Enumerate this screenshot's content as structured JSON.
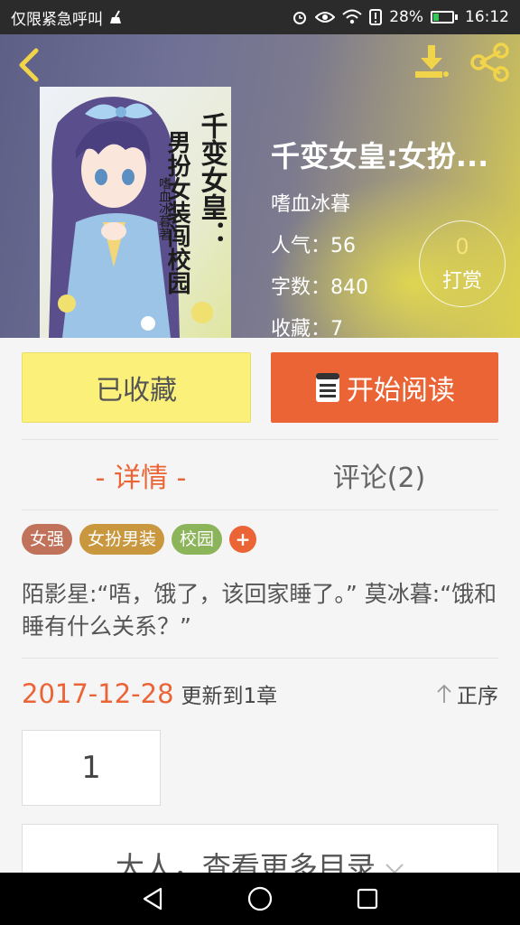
{
  "status_bar": {
    "carrier": "仅限紧急呼叫",
    "battery_pct": "28%",
    "battery_level": 0.28,
    "time": "16:12",
    "icons": [
      "broom-icon",
      "alarm-icon",
      "eye-icon",
      "wifi-icon",
      "sim-alert-icon",
      "battery-icon"
    ]
  },
  "book": {
    "title": "千变女皇:女扮...",
    "author": "嗜血冰暮",
    "popularity": "人气：56",
    "word_count": "字数：840",
    "favorites": "收藏：7",
    "cover_text": {
      "title_col1": "千变女皇：",
      "title_col2": "男扮女装闯校园",
      "author_col": "嗜血冰暮著"
    }
  },
  "tip": {
    "count": "0",
    "label": "打赏"
  },
  "actions": {
    "collected_label": "已收藏",
    "read_label": "开始阅读"
  },
  "tabs": [
    {
      "label": "- 详情 -",
      "active": true
    },
    {
      "label": "评论(2)",
      "active": false
    }
  ],
  "tags": [
    {
      "label": "女强",
      "color": "#c0725a"
    },
    {
      "label": "女扮男装",
      "color": "#c9973e"
    },
    {
      "label": "校园",
      "color": "#8cb45a"
    }
  ],
  "tag_add_label": "+",
  "description": "陌影星:“唔，饿了，该回家睡了。” 莫冰暮:“饿和睡有什么关系？”",
  "update": {
    "date": "2017-12-28",
    "text": "更新到1章",
    "order_label": "正序"
  },
  "chapter_number": "1",
  "more_catalog_label": "大人，查看更多目录",
  "colors": {
    "accent": "#eb6436",
    "collect_bg": "#fbf07a",
    "header_start": "#5d5f86",
    "header_end": "#d9cd4f"
  }
}
